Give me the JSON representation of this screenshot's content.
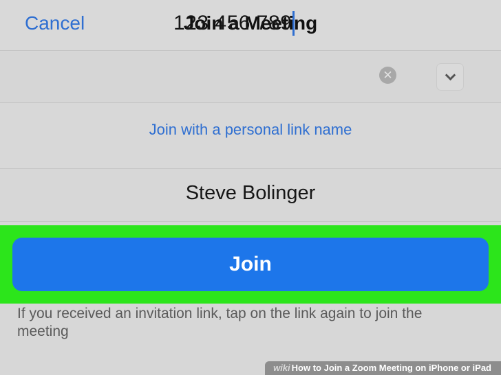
{
  "nav": {
    "cancel_label": "Cancel",
    "title": "Join a Meeting"
  },
  "meeting_id": {
    "value": "123 456 789"
  },
  "personal_link": {
    "label": "Join with a personal link name"
  },
  "name_field": {
    "value": "Steve Bolinger"
  },
  "join_button": {
    "label": "Join"
  },
  "hint": {
    "text": "If you received an invitation link, tap on the link again to join the meeting"
  },
  "watermark": {
    "prefix": "wiki",
    "text": "How to Join a Zoom Meeting on iPhone or iPad"
  },
  "colors": {
    "accent": "#2f6fd1",
    "join_button": "#1d76ea",
    "highlight": "#2ce51b",
    "background": "#d7d7d7"
  },
  "icons": [
    "clear-icon",
    "chevron-down-icon"
  ]
}
